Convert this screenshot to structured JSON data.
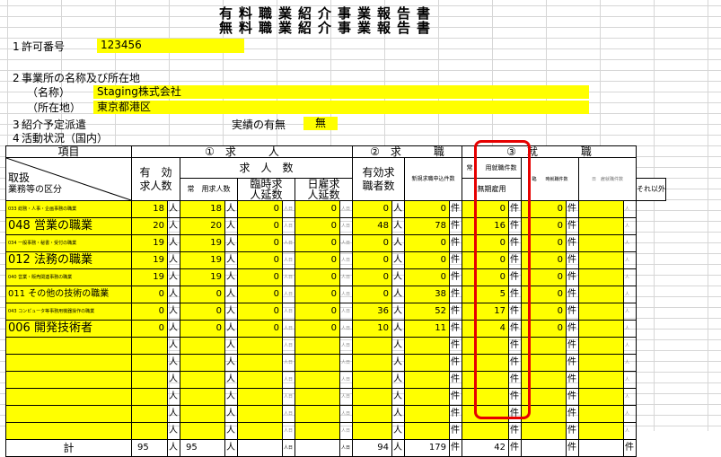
{
  "title_line1": "有料職業紹介事業報告書",
  "title_line2": "無料職業紹介事業報告書",
  "section1": {
    "num": "1",
    "label": "許可番号",
    "value": "123456"
  },
  "section2": {
    "num": "2",
    "label": "事業所の名称及び所在地",
    "name_label": "（名称）",
    "name_value": "Staging株式会社",
    "addr_label": "（所在地）",
    "addr_value": "東京都港区"
  },
  "section3": {
    "num": "3",
    "label": "紹介予定派遣",
    "record_label": "実績の有無",
    "record_value": "無"
  },
  "section4": {
    "num": "4",
    "label": "活動状況（国内）"
  },
  "table": {
    "h_item": "項目",
    "h_offer_num": "①",
    "h_offer": "求　　　人",
    "h_seek_num": "②",
    "h_seek": "求　　　職",
    "h_emp_num": "③",
    "h_emp": "就　　　　職",
    "h_toriatsukai": "取扱",
    "h_category": "業務等の区分",
    "h_valid_offers": "有　効\n求人数",
    "h_offer_count": "求　人　数",
    "h_regular": "常　用求人数",
    "h_temp": "臨時求\n人延数",
    "h_daily": "日雇求\n人延数",
    "h_valid_seekers": "有効求\n職者数",
    "h_new_seekers": "新規求職申込件数",
    "h_regular_emp": "常　　用就職件数",
    "h_indefinite": "無期雇用",
    "h_other": "それ以外",
    "h_temp_emp": "臨　　時就職件数",
    "h_daily_emp": "日　雇就職件数",
    "unit_person": "人",
    "unit_person_day": "人日",
    "unit_case": "件",
    "rows": [
      {
        "cat": "033 総務・人事・企画事務の職業",
        "size": "sm",
        "a": "18",
        "b": "18",
        "c": "0",
        "d": "0",
        "e": "0",
        "f": "0",
        "g": "0",
        "h": "0"
      },
      {
        "cat": "048 営業の職業",
        "size": "big",
        "a": "20",
        "b": "20",
        "c": "0",
        "d": "0",
        "e": "48",
        "f": "78",
        "g": "16",
        "h": "0"
      },
      {
        "cat": "034 一般事務・秘書・受付の職業",
        "size": "sm",
        "a": "19",
        "b": "19",
        "c": "0",
        "d": "0",
        "e": "0",
        "f": "0",
        "g": "0",
        "h": "0"
      },
      {
        "cat": "012 法務の職業",
        "size": "big",
        "a": "19",
        "b": "19",
        "c": "0",
        "d": "0",
        "e": "0",
        "f": "0",
        "g": "0",
        "h": "0"
      },
      {
        "cat": "040 営業・販売関連事務の職業",
        "size": "sm",
        "a": "19",
        "b": "19",
        "c": "0",
        "d": "0",
        "e": "0",
        "f": "0",
        "g": "0",
        "h": "0"
      },
      {
        "cat": "011 その他の技術の職業",
        "size": "md",
        "a": "0",
        "b": "0",
        "c": "0",
        "d": "0",
        "e": "0",
        "f": "38",
        "g": "5",
        "h": "0"
      },
      {
        "cat": "043 コンピュータ等事務用機器操作の職業",
        "size": "sm",
        "a": "0",
        "b": "0",
        "c": "0",
        "d": "0",
        "e": "36",
        "f": "52",
        "g": "17",
        "h": "0"
      },
      {
        "cat": "006 開発技術者",
        "size": "big",
        "a": "0",
        "b": "0",
        "c": "0",
        "d": "0",
        "e": "10",
        "f": "11",
        "g": "4",
        "h": "0"
      },
      {
        "cat": "",
        "size": "md",
        "a": "",
        "b": "",
        "c": "",
        "d": "",
        "e": "",
        "f": "",
        "g": "",
        "h": ""
      },
      {
        "cat": "",
        "size": "md",
        "a": "",
        "b": "",
        "c": "",
        "d": "",
        "e": "",
        "f": "",
        "g": "",
        "h": ""
      },
      {
        "cat": "",
        "size": "md",
        "a": "",
        "b": "",
        "c": "",
        "d": "",
        "e": "",
        "f": "",
        "g": "",
        "h": ""
      },
      {
        "cat": "",
        "size": "md",
        "a": "",
        "b": "",
        "c": "",
        "d": "",
        "e": "",
        "f": "",
        "g": "",
        "h": ""
      },
      {
        "cat": "",
        "size": "md",
        "a": "",
        "b": "",
        "c": "",
        "d": "",
        "e": "",
        "f": "",
        "g": "",
        "h": ""
      },
      {
        "cat": "",
        "size": "md",
        "a": "",
        "b": "",
        "c": "",
        "d": "",
        "e": "",
        "f": "",
        "g": "",
        "h": ""
      }
    ],
    "total": {
      "label": "計",
      "a": "95",
      "b": "95",
      "e": "94",
      "f": "179",
      "g": "42"
    }
  }
}
